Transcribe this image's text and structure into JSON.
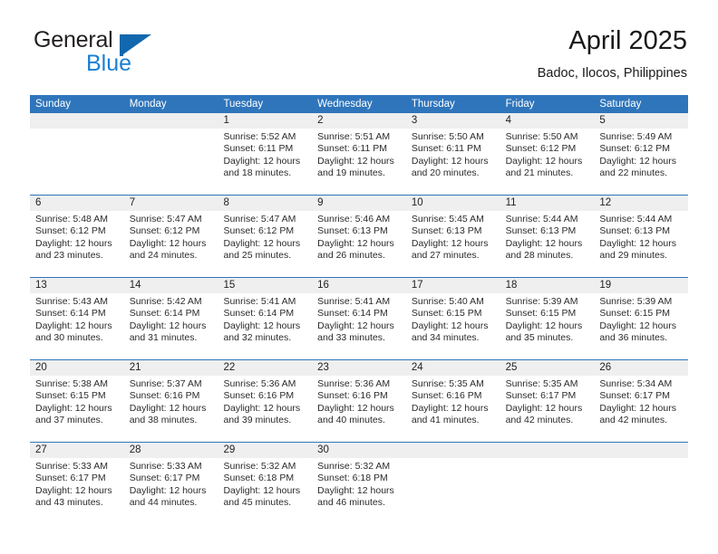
{
  "brand": {
    "name_part1": "General",
    "name_part2": "Blue",
    "flag_icon": "flag-icon",
    "accent_dark": "#1168ae",
    "accent_light": "#1b7fd4"
  },
  "header": {
    "title": "April 2025",
    "subtitle": "Badoc, Ilocos, Philippines"
  },
  "theme": {
    "header_blue": "#2f75bb",
    "date_band_gray": "#efefef",
    "cell_white": "#ffffff",
    "text": "#222222"
  },
  "calendar": {
    "weekdays": [
      "Sunday",
      "Monday",
      "Tuesday",
      "Wednesday",
      "Thursday",
      "Friday",
      "Saturday"
    ],
    "weeks": [
      [
        {
          "day": "",
          "lines": []
        },
        {
          "day": "",
          "lines": []
        },
        {
          "day": "1",
          "lines": [
            "Sunrise: 5:52 AM",
            "Sunset: 6:11 PM",
            "Daylight: 12 hours",
            "and 18 minutes."
          ]
        },
        {
          "day": "2",
          "lines": [
            "Sunrise: 5:51 AM",
            "Sunset: 6:11 PM",
            "Daylight: 12 hours",
            "and 19 minutes."
          ]
        },
        {
          "day": "3",
          "lines": [
            "Sunrise: 5:50 AM",
            "Sunset: 6:11 PM",
            "Daylight: 12 hours",
            "and 20 minutes."
          ]
        },
        {
          "day": "4",
          "lines": [
            "Sunrise: 5:50 AM",
            "Sunset: 6:12 PM",
            "Daylight: 12 hours",
            "and 21 minutes."
          ]
        },
        {
          "day": "5",
          "lines": [
            "Sunrise: 5:49 AM",
            "Sunset: 6:12 PM",
            "Daylight: 12 hours",
            "and 22 minutes."
          ]
        }
      ],
      [
        {
          "day": "6",
          "lines": [
            "Sunrise: 5:48 AM",
            "Sunset: 6:12 PM",
            "Daylight: 12 hours",
            "and 23 minutes."
          ]
        },
        {
          "day": "7",
          "lines": [
            "Sunrise: 5:47 AM",
            "Sunset: 6:12 PM",
            "Daylight: 12 hours",
            "and 24 minutes."
          ]
        },
        {
          "day": "8",
          "lines": [
            "Sunrise: 5:47 AM",
            "Sunset: 6:12 PM",
            "Daylight: 12 hours",
            "and 25 minutes."
          ]
        },
        {
          "day": "9",
          "lines": [
            "Sunrise: 5:46 AM",
            "Sunset: 6:13 PM",
            "Daylight: 12 hours",
            "and 26 minutes."
          ]
        },
        {
          "day": "10",
          "lines": [
            "Sunrise: 5:45 AM",
            "Sunset: 6:13 PM",
            "Daylight: 12 hours",
            "and 27 minutes."
          ]
        },
        {
          "day": "11",
          "lines": [
            "Sunrise: 5:44 AM",
            "Sunset: 6:13 PM",
            "Daylight: 12 hours",
            "and 28 minutes."
          ]
        },
        {
          "day": "12",
          "lines": [
            "Sunrise: 5:44 AM",
            "Sunset: 6:13 PM",
            "Daylight: 12 hours",
            "and 29 minutes."
          ]
        }
      ],
      [
        {
          "day": "13",
          "lines": [
            "Sunrise: 5:43 AM",
            "Sunset: 6:14 PM",
            "Daylight: 12 hours",
            "and 30 minutes."
          ]
        },
        {
          "day": "14",
          "lines": [
            "Sunrise: 5:42 AM",
            "Sunset: 6:14 PM",
            "Daylight: 12 hours",
            "and 31 minutes."
          ]
        },
        {
          "day": "15",
          "lines": [
            "Sunrise: 5:41 AM",
            "Sunset: 6:14 PM",
            "Daylight: 12 hours",
            "and 32 minutes."
          ]
        },
        {
          "day": "16",
          "lines": [
            "Sunrise: 5:41 AM",
            "Sunset: 6:14 PM",
            "Daylight: 12 hours",
            "and 33 minutes."
          ]
        },
        {
          "day": "17",
          "lines": [
            "Sunrise: 5:40 AM",
            "Sunset: 6:15 PM",
            "Daylight: 12 hours",
            "and 34 minutes."
          ]
        },
        {
          "day": "18",
          "lines": [
            "Sunrise: 5:39 AM",
            "Sunset: 6:15 PM",
            "Daylight: 12 hours",
            "and 35 minutes."
          ]
        },
        {
          "day": "19",
          "lines": [
            "Sunrise: 5:39 AM",
            "Sunset: 6:15 PM",
            "Daylight: 12 hours",
            "and 36 minutes."
          ]
        }
      ],
      [
        {
          "day": "20",
          "lines": [
            "Sunrise: 5:38 AM",
            "Sunset: 6:15 PM",
            "Daylight: 12 hours",
            "and 37 minutes."
          ]
        },
        {
          "day": "21",
          "lines": [
            "Sunrise: 5:37 AM",
            "Sunset: 6:16 PM",
            "Daylight: 12 hours",
            "and 38 minutes."
          ]
        },
        {
          "day": "22",
          "lines": [
            "Sunrise: 5:36 AM",
            "Sunset: 6:16 PM",
            "Daylight: 12 hours",
            "and 39 minutes."
          ]
        },
        {
          "day": "23",
          "lines": [
            "Sunrise: 5:36 AM",
            "Sunset: 6:16 PM",
            "Daylight: 12 hours",
            "and 40 minutes."
          ]
        },
        {
          "day": "24",
          "lines": [
            "Sunrise: 5:35 AM",
            "Sunset: 6:16 PM",
            "Daylight: 12 hours",
            "and 41 minutes."
          ]
        },
        {
          "day": "25",
          "lines": [
            "Sunrise: 5:35 AM",
            "Sunset: 6:17 PM",
            "Daylight: 12 hours",
            "and 42 minutes."
          ]
        },
        {
          "day": "26",
          "lines": [
            "Sunrise: 5:34 AM",
            "Sunset: 6:17 PM",
            "Daylight: 12 hours",
            "and 42 minutes."
          ]
        }
      ],
      [
        {
          "day": "27",
          "lines": [
            "Sunrise: 5:33 AM",
            "Sunset: 6:17 PM",
            "Daylight: 12 hours",
            "and 43 minutes."
          ]
        },
        {
          "day": "28",
          "lines": [
            "Sunrise: 5:33 AM",
            "Sunset: 6:17 PM",
            "Daylight: 12 hours",
            "and 44 minutes."
          ]
        },
        {
          "day": "29",
          "lines": [
            "Sunrise: 5:32 AM",
            "Sunset: 6:18 PM",
            "Daylight: 12 hours",
            "and 45 minutes."
          ]
        },
        {
          "day": "30",
          "lines": [
            "Sunrise: 5:32 AM",
            "Sunset: 6:18 PM",
            "Daylight: 12 hours",
            "and 46 minutes."
          ]
        },
        {
          "day": "",
          "lines": []
        },
        {
          "day": "",
          "lines": []
        },
        {
          "day": "",
          "lines": []
        }
      ]
    ]
  }
}
